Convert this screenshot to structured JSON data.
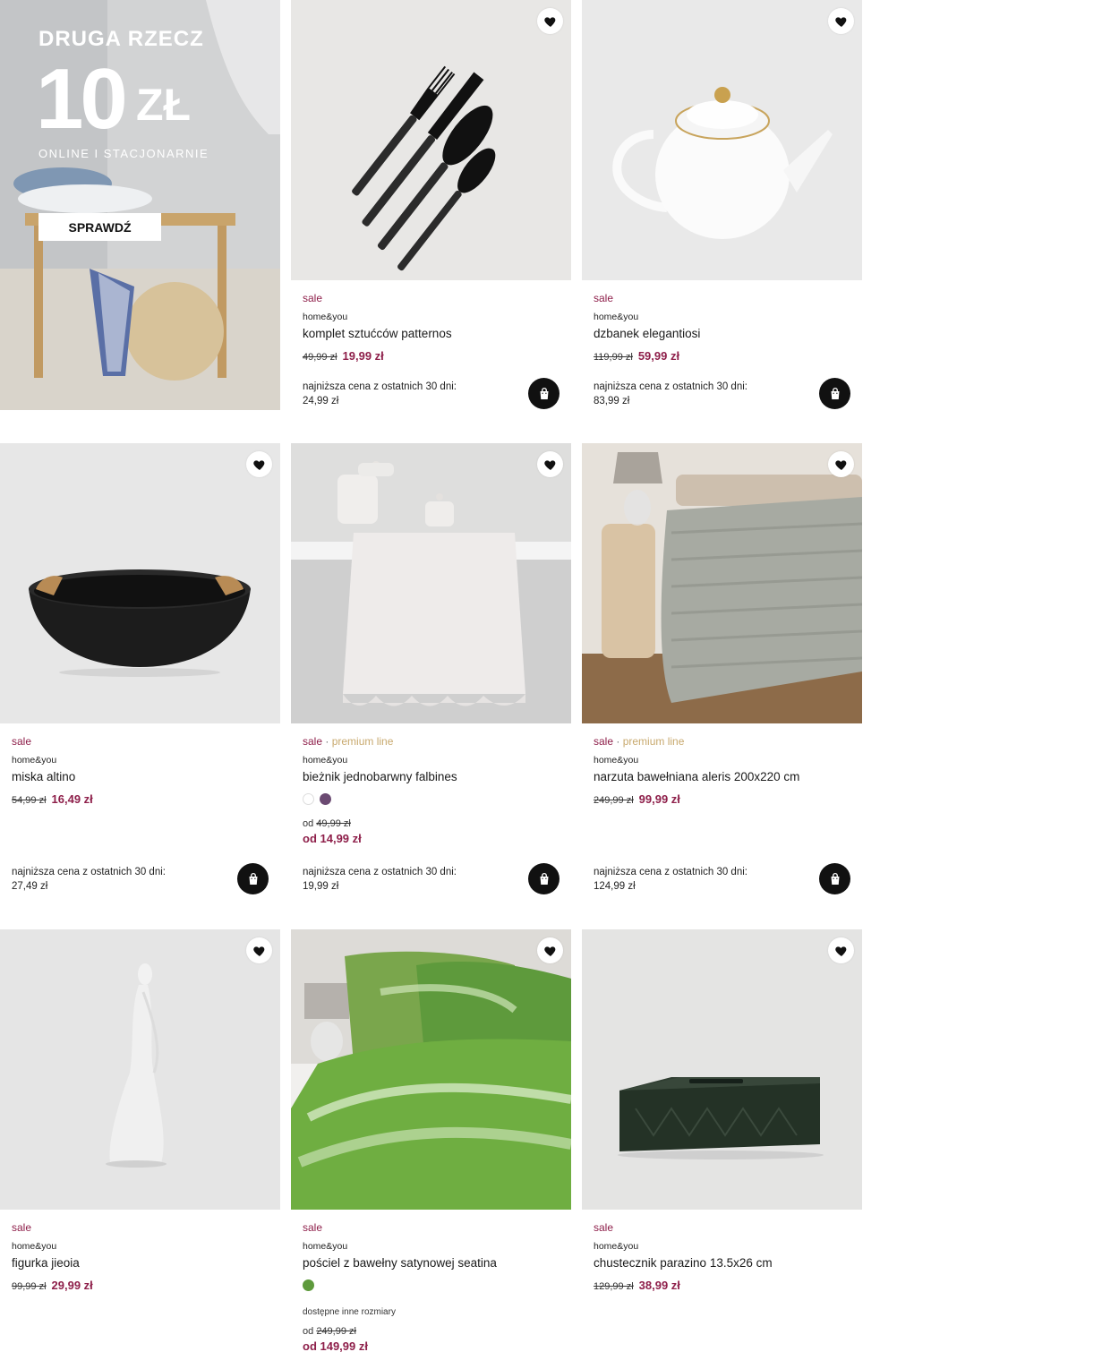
{
  "banner": {
    "title": "DRUGA RZECZ",
    "amount": "10",
    "unit": "ZŁ",
    "subtitle": "ONLINE I STACJONARNIE",
    "button": "SPRAWDŹ"
  },
  "labels": {
    "sale": "sale",
    "premium": "premium line",
    "dot": "·",
    "lowest": "najniższa cena z ostatnich 30 dni:",
    "from": "od",
    "other_sizes": "dostępne inne rozmiary"
  },
  "products": [
    {
      "brand": "home&you",
      "name": "komplet sztućców patternos",
      "old_price": "49,99 zł",
      "new_price": "19,99 zł",
      "lowest": "24,99 zł"
    },
    {
      "brand": "home&you",
      "name": "dzbanek elegantiosi",
      "old_price": "119,99 zł",
      "new_price": "59,99 zł",
      "lowest": "83,99 zł"
    },
    {
      "brand": "home&you",
      "name": "miska altino",
      "old_price": "54,99 zł",
      "new_price": "16,49 zł",
      "lowest": "27,49 zł"
    },
    {
      "brand": "home&you",
      "name": "bieżnik jednobarwny falbines",
      "old_price": "49,99 zł",
      "new_price": "od 14,99 zł",
      "lowest": "19,99 zł",
      "swatches": [
        "#ffffff",
        "#6b4a72"
      ]
    },
    {
      "brand": "home&you",
      "name": "narzuta bawełniana aleris 200x220 cm",
      "old_price": "249,99 zł",
      "new_price": "99,99 zł",
      "lowest": "124,99 zł"
    },
    {
      "brand": "home&you",
      "name": "figurka jieoia",
      "old_price": "99,99 zł",
      "new_price": "29,99 zł"
    },
    {
      "brand": "home&you",
      "name": "pościel z bawełny satynowej seatina",
      "old_price": "249,99 zł",
      "new_price": "od 149,99 zł",
      "swatches": [
        "#5e9a3c"
      ]
    },
    {
      "brand": "home&you",
      "name": "chustecznik parazino 13.5x26 cm",
      "old_price": "129,99 zł",
      "new_price": "38,99 zł"
    }
  ],
  "colors": {
    "sale": "#8e1f4a",
    "premium": "#c8a96e",
    "cart": "#111111"
  }
}
